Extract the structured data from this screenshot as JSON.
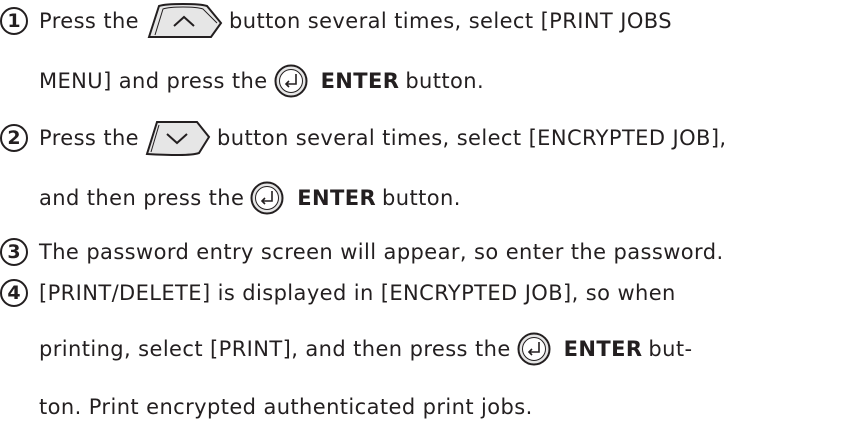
{
  "steps": [
    {
      "number": "1",
      "line1_before": "Press the",
      "line1_after": "button several times, select [PRINT JOBS",
      "line2_before": "MENU] and press the",
      "line2_bold": "ENTER",
      "line2_after": "button.",
      "icon1": "up-arrow-button-icon",
      "icon2": "enter-button-icon"
    },
    {
      "number": "2",
      "line1_before": "Press the",
      "line1_after": "button several times, select [ENCRYPTED JOB],",
      "line2_before": "and then press the",
      "line2_bold": "ENTER",
      "line2_after": "button.",
      "icon1": "down-arrow-button-icon",
      "icon2": "enter-button-icon"
    },
    {
      "number": "3",
      "text": "The password entry screen will appear, so enter the password."
    },
    {
      "number": "4",
      "line1": "[PRINT/DELETE] is displayed in [ENCRYPTED JOB], so when",
      "line2_before": "printing, select [PRINT], and then press the",
      "line2_bold": "ENTER",
      "line2_after": "but-",
      "line3": "ton. Print encrypted authenticated print jobs.",
      "icon2": "enter-button-icon"
    }
  ]
}
